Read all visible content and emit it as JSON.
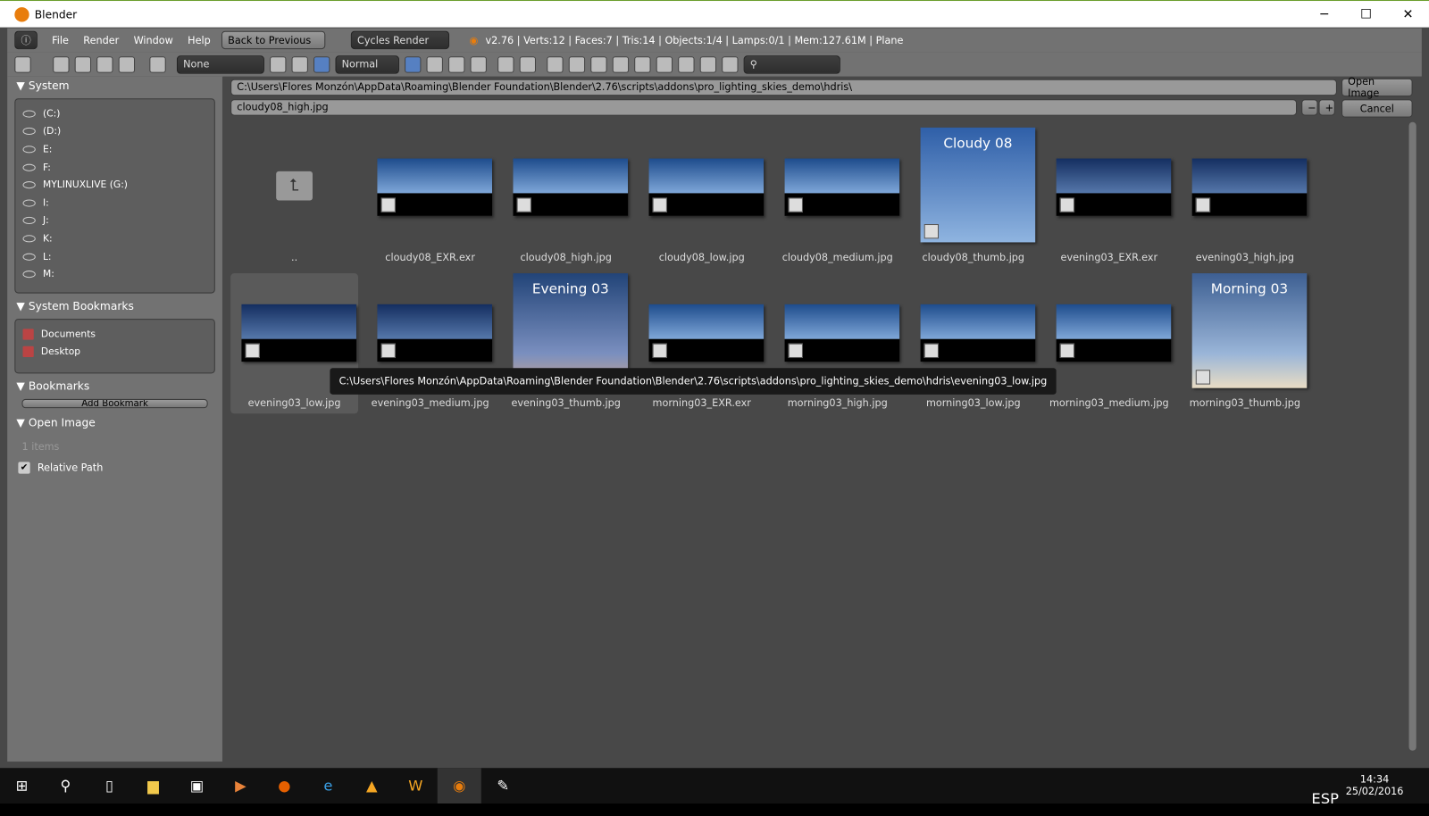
{
  "window": {
    "title": "Blender"
  },
  "header": {
    "menus": [
      "File",
      "Render",
      "Window",
      "Help"
    ],
    "back": "Back to Previous",
    "engine": "Cycles Render",
    "stats": "v2.76 | Verts:12 | Faces:7 | Tris:14 | Objects:1/4 | Lamps:0/1 | Mem:127.61M | Plane"
  },
  "toolbar": {
    "filter": "None",
    "display": "Normal"
  },
  "sidebar": {
    "system": "System",
    "drives": [
      "(C:)",
      "(D:)",
      "E:",
      "F:",
      "MYLINUXLIVE (G:)",
      "I:",
      "J:",
      "K:",
      "L:",
      "M:"
    ],
    "bookmarks_title": "System Bookmarks",
    "bookmarks": [
      "Documents",
      "Desktop"
    ],
    "user_bookmarks": "Bookmarks",
    "add_bookmark": "Add Bookmark",
    "open_image": "Open Image",
    "items": "1 items",
    "relative_path": "Relative Path"
  },
  "browser": {
    "directory": "C:\\Users\\Flores Monzón\\AppData\\Roaming\\Blender Foundation\\Blender\\2.76\\scripts\\addons\\pro_lighting_skies_demo\\hdris\\",
    "filename": "cloudy08_high.jpg",
    "open": "Open Image",
    "cancel": "Cancel",
    "files": [
      {
        "name": "..",
        "kind": "parent"
      },
      {
        "name": "cloudy08_EXR.exr",
        "kind": "sky"
      },
      {
        "name": "cloudy08_high.jpg",
        "kind": "sky"
      },
      {
        "name": "cloudy08_low.jpg",
        "kind": "sky"
      },
      {
        "name": "cloudy08_medium.jpg",
        "kind": "sky"
      },
      {
        "name": "cloudy08_thumb.jpg",
        "kind": "big",
        "caption": "Cloudy 08"
      },
      {
        "name": "evening03_EXR.exr",
        "kind": "ev"
      },
      {
        "name": "evening03_high.jpg",
        "kind": "ev"
      },
      {
        "name": "evening03_low.jpg",
        "kind": "ev"
      },
      {
        "name": "evening03_medium.jpg",
        "kind": "ev"
      },
      {
        "name": "evening03_thumb.jpg",
        "kind": "bigev",
        "caption": "Evening 03"
      },
      {
        "name": "morning03_EXR.exr",
        "kind": "sky"
      },
      {
        "name": "morning03_high.jpg",
        "kind": "sky"
      },
      {
        "name": "morning03_low.jpg",
        "kind": "sky"
      },
      {
        "name": "morning03_medium.jpg",
        "kind": "sky"
      },
      {
        "name": "morning03_thumb.jpg",
        "kind": "bigmo",
        "caption": "Morning 03"
      }
    ],
    "tooltip": "C:\\Users\\Flores Monzón\\AppData\\Roaming\\Blender Foundation\\Blender\\2.76\\scripts\\addons\\pro_lighting_skies_demo\\hdris\\evening03_low.jpg"
  },
  "taskbar": {
    "lang": "ESP",
    "time": "14:34",
    "date": "25/02/2016"
  }
}
